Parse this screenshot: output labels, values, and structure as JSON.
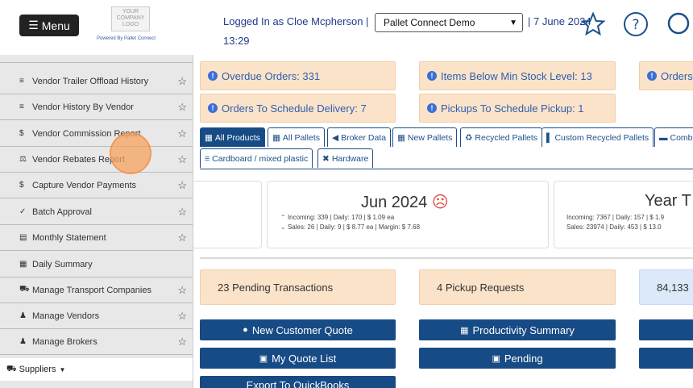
{
  "header": {
    "menu_label": "Menu",
    "logo_lines": [
      "YOUR",
      "COMPANY",
      "LOGO"
    ],
    "logo_caption": "Powered By Pallet Connect",
    "logged_in_text": "Logged In as Cloe Mcpherson |",
    "company_select_value": "Pallet Connect Demo",
    "date_text": "| 7 June 2024",
    "time_text": "13:29"
  },
  "sidebar": {
    "items": [
      {
        "icon": "list-icon",
        "label": "Vendor Trailer Offload History",
        "star": true
      },
      {
        "icon": "list-icon",
        "label": "Vendor History By Vendor",
        "star": true
      },
      {
        "icon": "dollar-icon",
        "label": "Vendor Commission Report",
        "star": true
      },
      {
        "icon": "scale-icon",
        "label": "Vendor Rebates Report",
        "star": true
      },
      {
        "icon": "dollar-icon",
        "label": "Capture Vendor Payments",
        "star": true
      },
      {
        "icon": "check-icon",
        "label": "Batch Approval",
        "star": true
      },
      {
        "icon": "statement-icon",
        "label": "Monthly Statement",
        "star": true
      },
      {
        "icon": "table-icon",
        "label": "Daily Summary",
        "star": false
      },
      {
        "icon": "truck-icon",
        "label": "Manage Transport Companies",
        "star": true
      },
      {
        "icon": "users-icon",
        "label": "Manage Vendors",
        "star": true
      },
      {
        "icon": "users-icon",
        "label": "Manage Brokers",
        "star": true
      }
    ],
    "suppliers_label": "Suppliers"
  },
  "alerts": [
    {
      "label": "Overdue Orders: 331"
    },
    {
      "label": "Items Below Min Stock Level: 13"
    },
    {
      "label": "Orders"
    },
    {
      "label": "Orders To Schedule Delivery: 7"
    },
    {
      "label": "Pickups To Schedule Pickup: 1"
    }
  ],
  "tabs": [
    {
      "label": "All Products",
      "active": true
    },
    {
      "label": "All Pallets",
      "active": false
    },
    {
      "label": "Broker Data",
      "active": false
    },
    {
      "label": "New Pallets",
      "active": false
    },
    {
      "label": "Recycled Pallets",
      "active": false
    },
    {
      "label": "Custom Recycled Pallets",
      "active": false
    },
    {
      "label": "Comb",
      "active": false
    },
    {
      "label": "Cardboard / mixed plastic",
      "active": false
    },
    {
      "label": "Hardware",
      "active": false
    }
  ],
  "stats": {
    "month": {
      "title": "Jun 2024",
      "incoming": "Incoming: 339 | Daily: 170 | $ 1.09 ea",
      "sales": "Sales: 26 | Daily: 9 | $ 8.77 ea | Margin: $ 7.68"
    },
    "year": {
      "title": "Year T",
      "incoming": "Incoming: 7367 | Daily: 157 | $ 1.9",
      "sales": "Sales: 23974 | Daily: 453 | $ 13.0"
    }
  },
  "summary": {
    "pending_transactions": "23 Pending Transactions",
    "pickup_requests": "4 Pickup Requests",
    "third_value": "84,133"
  },
  "buttons": {
    "new_customer_quote": "New Customer Quote",
    "productivity_summary": "Productivity Summary",
    "my_quote_list": "My Quote List",
    "pending": "Pending",
    "export_quickbooks": "Export To QuickBooks"
  },
  "colors": {
    "primary": "#174b85",
    "alert_bg": "#fbe3c9",
    "info_bg": "#dbe9fa",
    "sidebar_bg": "#e8e8e8"
  }
}
